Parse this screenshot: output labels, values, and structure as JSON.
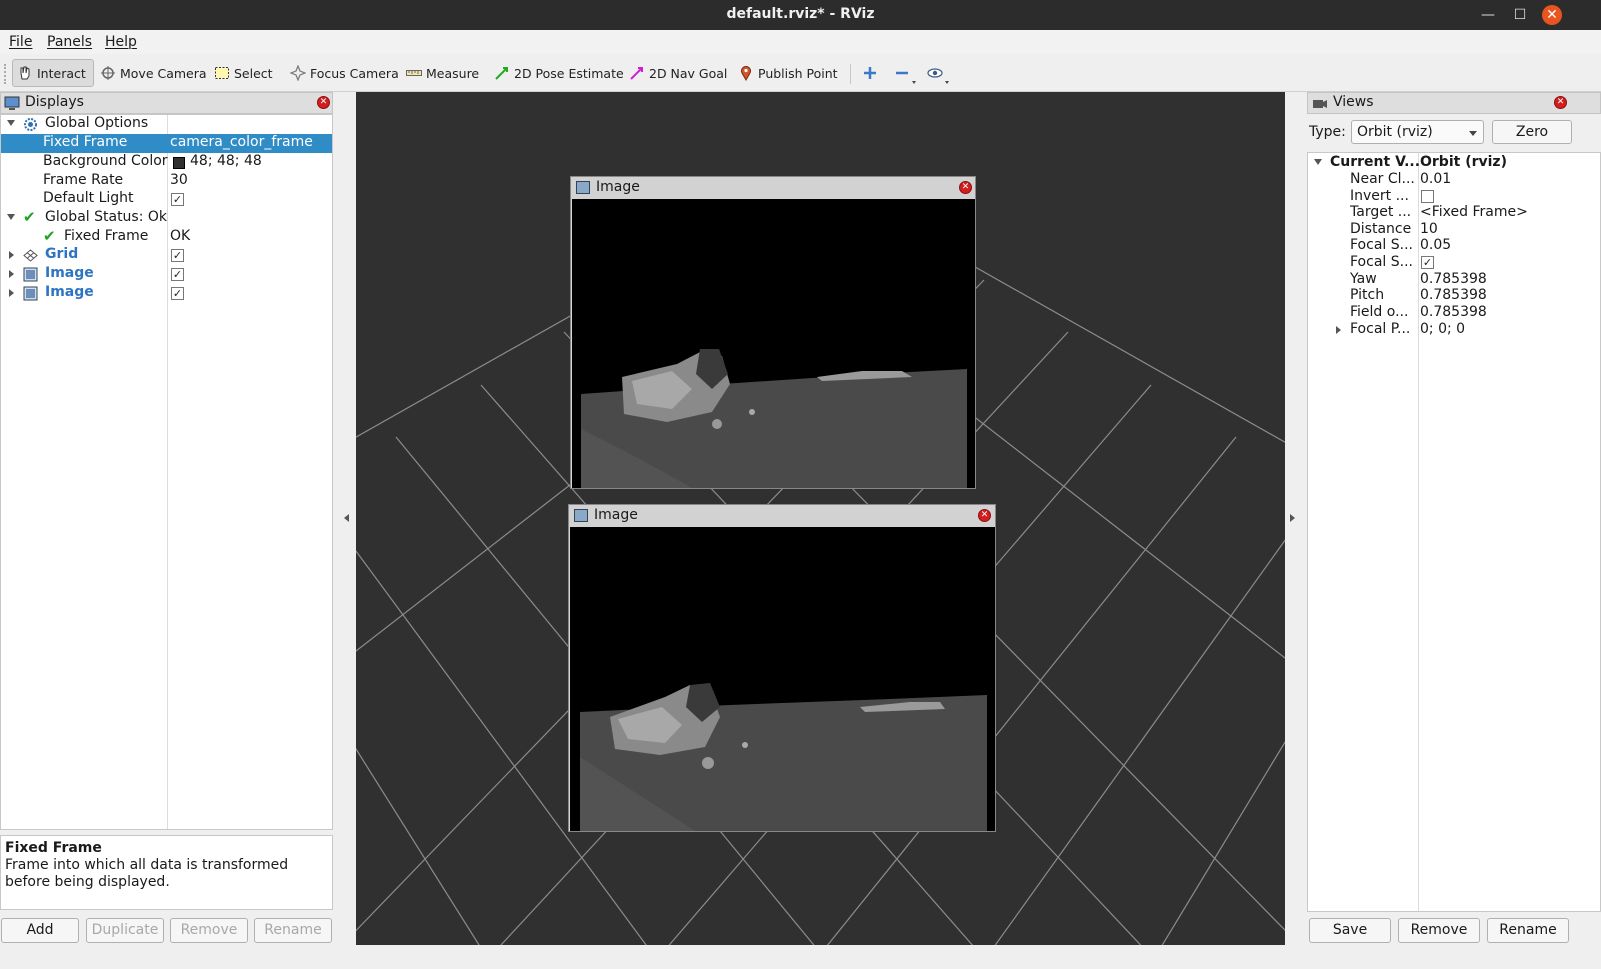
{
  "window": {
    "title": "default.rviz* - RViz"
  },
  "menu": [
    "File",
    "Panels",
    "Help"
  ],
  "toolbar": {
    "interact": "Interact",
    "move_camera": "Move Camera",
    "select": "Select",
    "focus_camera": "Focus Camera",
    "measure": "Measure",
    "pose_estimate": "2D Pose Estimate",
    "nav_goal": "2D Nav Goal",
    "publish_point": "Publish Point"
  },
  "displays": {
    "title": "Displays",
    "global_options": "Global Options",
    "fixed_frame_key": "Fixed Frame",
    "fixed_frame_val": "camera_color_frame",
    "bg_color_key": "Background Color",
    "bg_color_val": "48; 48; 48",
    "frame_rate_key": "Frame Rate",
    "frame_rate_val": "30",
    "default_light_key": "Default Light",
    "global_status": "Global Status: Ok",
    "status_fixed_frame": "Fixed Frame",
    "status_ok": "OK",
    "grid": "Grid",
    "image1": "Image",
    "image2": "Image",
    "checkmark": "✓",
    "description_title": "Fixed Frame",
    "description_text": "Frame into which all data is transformed before being displayed."
  },
  "display_buttons": {
    "add": "Add",
    "duplicate": "Duplicate",
    "remove": "Remove",
    "rename": "Rename"
  },
  "image_windows": {
    "top_title": "Image",
    "bottom_title": "Image"
  },
  "views": {
    "title": "Views",
    "type_label": "Type:",
    "type_value": "Orbit (rviz)",
    "zero": "Zero",
    "current_view_key": "Current V...",
    "current_view_val": "Orbit (rviz)",
    "props": [
      {
        "k": "Near Cl...",
        "v": "0.01"
      },
      {
        "k": "Invert ...",
        "v": ""
      },
      {
        "k": "Target ...",
        "v": "<Fixed Frame>"
      },
      {
        "k": "Distance",
        "v": "10"
      },
      {
        "k": "Focal S...",
        "v": "0.05"
      },
      {
        "k": "Focal S...",
        "v": ""
      },
      {
        "k": "Yaw",
        "v": "0.785398"
      },
      {
        "k": "Pitch",
        "v": "0.785398"
      },
      {
        "k": "Field o...",
        "v": "0.785398"
      },
      {
        "k": "Focal P...",
        "v": "0; 0; 0"
      }
    ],
    "save": "Save",
    "remove": "Remove",
    "rename": "Rename"
  },
  "colors": {
    "selection": "#308cc6",
    "viewport_bg": "#303030",
    "link_blue": "#2d74c4",
    "title_close": "#e95420"
  }
}
